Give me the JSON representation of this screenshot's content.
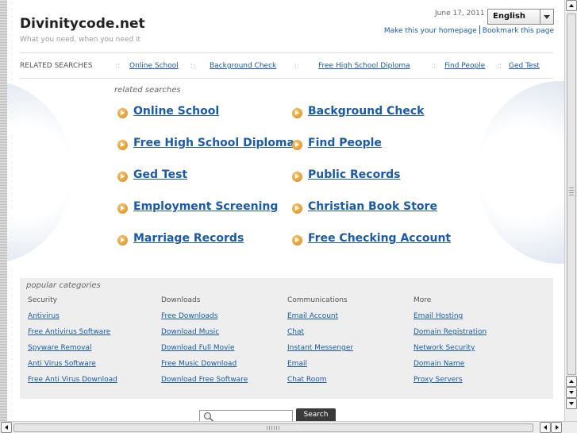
{
  "header": {
    "site_title": "Divinitycode.net",
    "tagline": "What you need, when you need it",
    "date": "June 17, 2011",
    "language": "English",
    "homepage_link": "Make this your homepage",
    "bookmark_link": "Bookmark this page"
  },
  "related_bar": {
    "label": "RELATED SEARCHES",
    "separator": "::",
    "items": [
      "Online School",
      "Background Check",
      "Free High School Diploma",
      "Find People",
      "Ged Test"
    ]
  },
  "related_searches": {
    "heading": "related searches",
    "left": [
      "Online School",
      "Free High School Diploma",
      "Ged Test",
      "Employment Screening",
      "Marriage Records"
    ],
    "right": [
      "Background Check",
      "Find People",
      "Public Records",
      "Christian Book Store",
      "Free Checking Account"
    ],
    "icon": "arrow-circle-icon"
  },
  "popular": {
    "heading": "popular categories",
    "columns": [
      {
        "header": "Security",
        "items": [
          "Antivirus",
          "Free Antivirus Software",
          "Spyware Removal",
          "Anti Virus Software",
          "Free Anti Virus Download"
        ]
      },
      {
        "header": "Downloads",
        "items": [
          "Free Downloads",
          "Download Music",
          "Download Full Movie",
          "Free Music Download",
          "Download Free Software"
        ]
      },
      {
        "header": "Communications",
        "items": [
          "Email Account",
          "Chat",
          "Instant Messenger",
          "Email",
          "Chat Room"
        ]
      },
      {
        "header": "More",
        "items": [
          "Email Hosting",
          "Domain Registration",
          "Network Security",
          "Domain Name",
          "Proxy Servers"
        ]
      }
    ]
  },
  "search": {
    "button_label": "Search",
    "placeholder": ""
  },
  "colors": {
    "link": "#1a5aa8",
    "icon": "#e39a2f",
    "panel": "#eeeeee"
  }
}
